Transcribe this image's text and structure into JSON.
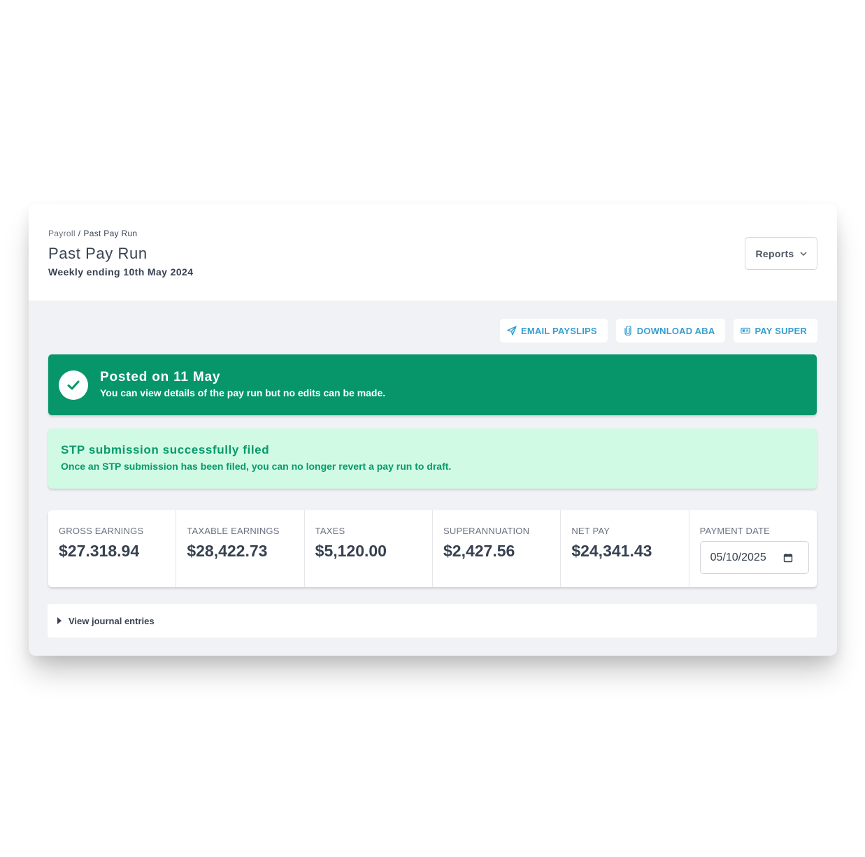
{
  "header": {
    "breadcrumb": {
      "parent": "Payroll",
      "separator": "/",
      "current": "Past Pay Run"
    },
    "title": "Past Pay Run",
    "subtitle": "Weekly ending 10th May 2024",
    "reports_label": "Reports"
  },
  "actions": [
    {
      "label": "EMAIL PAYSLIPS",
      "icon": "send-icon"
    },
    {
      "label": "DOWNLOAD ABA",
      "icon": "paperclip-icon"
    },
    {
      "label": "PAY SUPER",
      "icon": "ticket-icon"
    }
  ],
  "posted_banner": {
    "title": "Posted on 11 May",
    "message": "You can view details of the pay run but no edits can be made.",
    "color": "#069669"
  },
  "stp_banner": {
    "title": "STP submission successfully filed",
    "message": "Once an STP submission has been filed, you can no longer revert a pay run to draft.",
    "color": "#d1fae5"
  },
  "stats": [
    {
      "label": "GROSS EARNINGS",
      "value": "$27.318.94"
    },
    {
      "label": "TAXABLE EARNINGS",
      "value": "$28,422.73"
    },
    {
      "label": "TAXES",
      "value": "$5,120.00"
    },
    {
      "label": "SUPERANNUATION",
      "value": "$2,427.56"
    },
    {
      "label": "NET PAY",
      "value": "$24,341.43"
    }
  ],
  "payment_date": {
    "label": "PAYMENT DATE",
    "value": "05/10/2025"
  },
  "journal": {
    "label": "View journal entries"
  },
  "colors": {
    "accent": "#3a9fcf",
    "text": "#374151",
    "muted": "#6b7280"
  }
}
